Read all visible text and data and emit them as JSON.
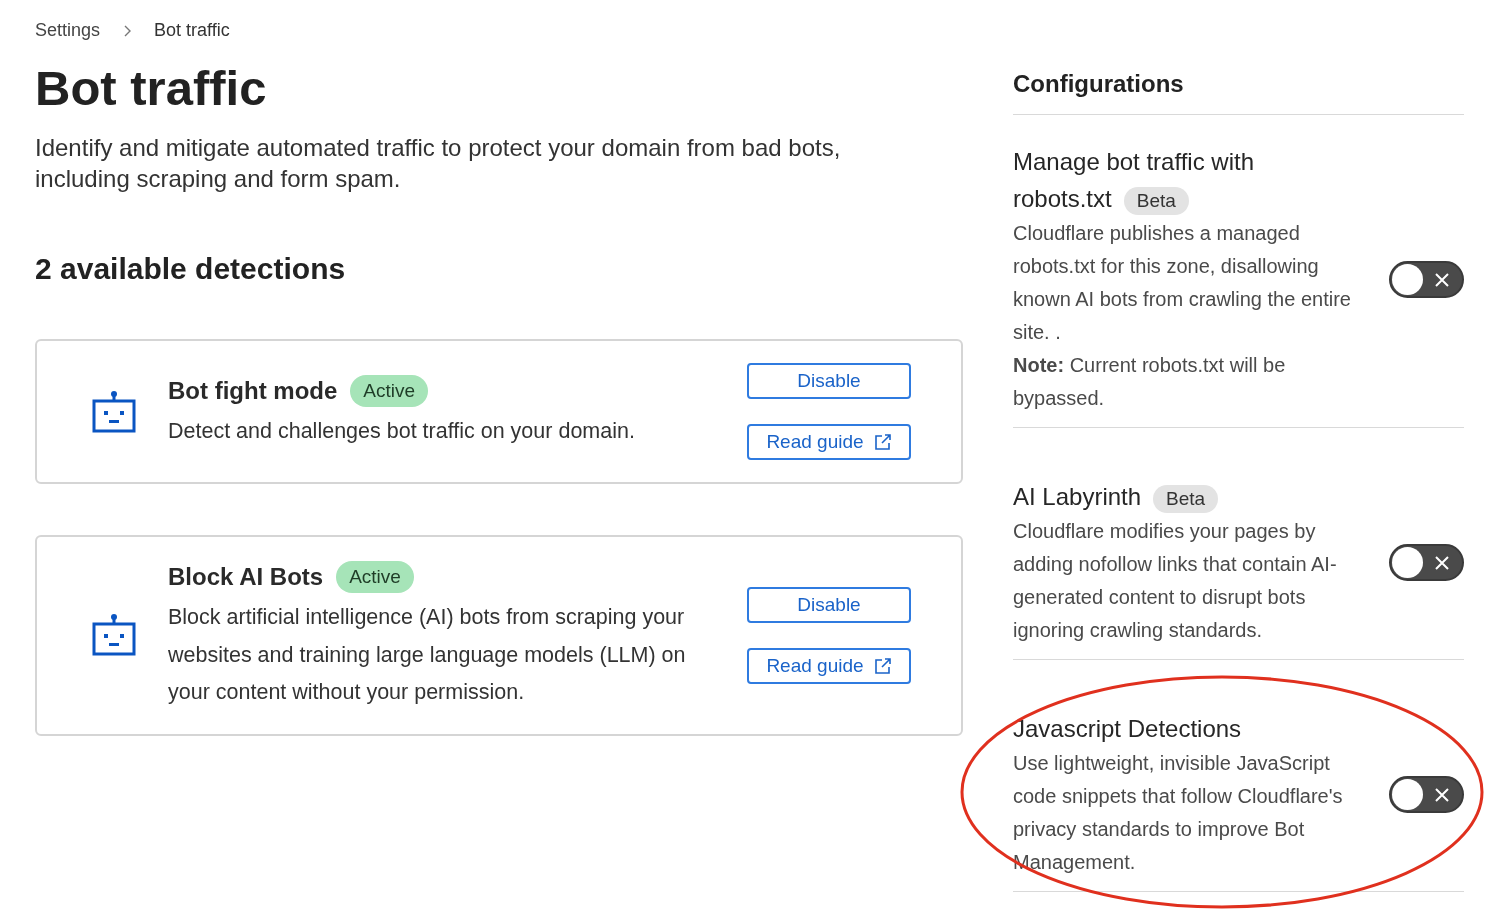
{
  "breadcrumb": [
    "Settings",
    "Bot traffic"
  ],
  "title": "Bot traffic",
  "description": "Identify and mitigate automated traffic to protect your domain from bad bots, including scraping and form spam.",
  "detections_heading": "2 available detections",
  "detections": [
    {
      "title": "Bot fight mode",
      "status": "Active",
      "description": "Detect and challenges bot traffic on your domain.",
      "buttons": [
        "Disable",
        "Read guide"
      ]
    },
    {
      "title": "Block AI Bots",
      "status": "Active",
      "description": "Block artificial intelligence (AI) bots from scraping your websites and training large language models (LLM) on your content without your permission.",
      "buttons": [
        "Disable",
        "Read guide"
      ]
    }
  ],
  "configurations": {
    "heading": "Configurations",
    "items": [
      {
        "title": "Manage bot traffic with robots.txt",
        "badge": "Beta",
        "paragraphs": [
          "Cloudflare publishes a managed robots.txt for this zone, disallowing known AI bots from crawling the entire site. .",
          "**Note:** Current robots.txt will be bypassed."
        ],
        "on": false,
        "circled": false
      },
      {
        "title": "AI Labyrinth",
        "badge": "Beta",
        "paragraphs": [
          "Cloudflare modifies your pages by adding nofollow links that contain AI-generated content to disrupt bots ignoring crawling standards."
        ],
        "on": false,
        "circled": false
      },
      {
        "title": "Javascript Detections",
        "paragraphs": [
          "Use lightweight, invisible JavaScript code snippets that follow Cloudflare's privacy standards to improve Bot Management."
        ],
        "on": false,
        "circled": true
      }
    ]
  }
}
